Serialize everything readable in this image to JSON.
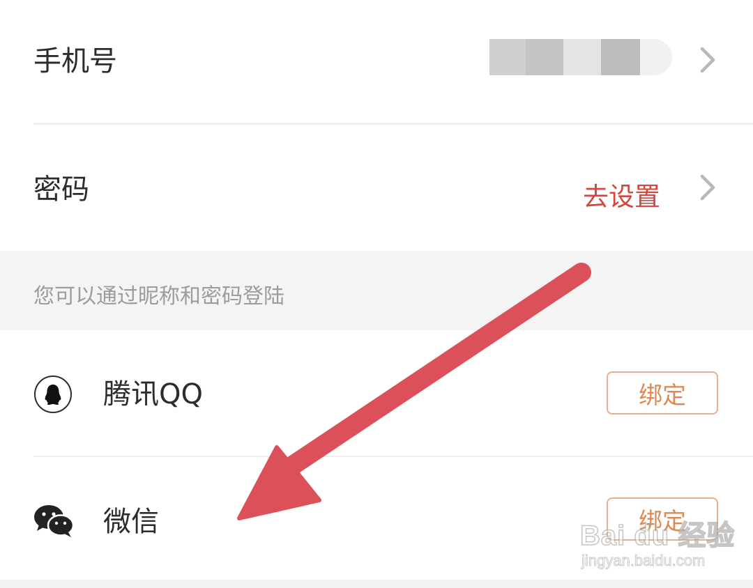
{
  "phone_row": {
    "label": "手机号"
  },
  "password_row": {
    "label": "密码",
    "action": "去设置"
  },
  "hint": "您可以通过昵称和密码登陆",
  "qq_row": {
    "label": "腾讯QQ",
    "button": "绑定",
    "icon": "qq-penguin-icon"
  },
  "wechat_row": {
    "label": "微信",
    "button": "绑定",
    "icon": "wechat-icon"
  },
  "watermark": {
    "brand": "Bai du 经验",
    "url": "jingyan.baidu.com"
  },
  "colors": {
    "accent_red": "#d4463e",
    "bind_text": "#dc8a55",
    "bind_border": "#e8b08c",
    "arrow": "#dc5159",
    "hint_background": "#f4f4f4"
  }
}
